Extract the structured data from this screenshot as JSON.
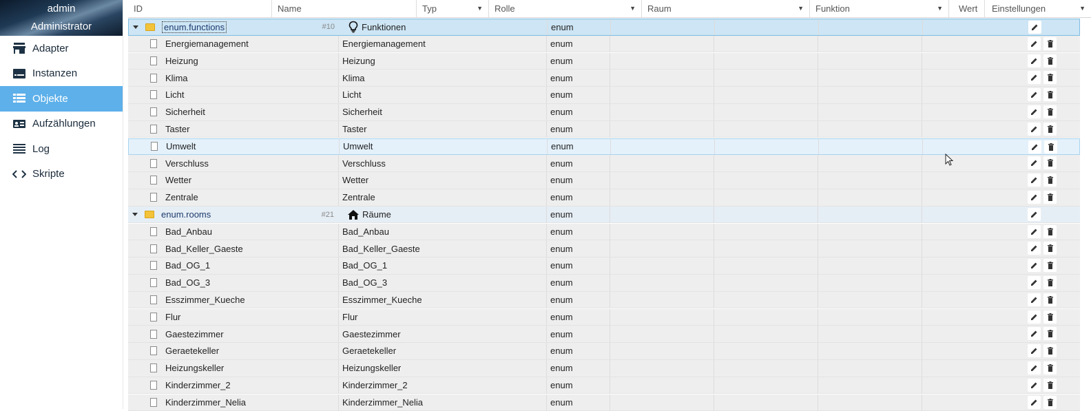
{
  "user": {
    "name": "admin",
    "role": "Administrator"
  },
  "nav": [
    {
      "label": "Adapter",
      "icon": "store-icon",
      "active": false
    },
    {
      "label": "Instanzen",
      "icon": "instances-icon",
      "active": false
    },
    {
      "label": "Objekte",
      "icon": "list-icon",
      "active": true
    },
    {
      "label": "Aufzählungen",
      "icon": "contact-card-icon",
      "active": false
    },
    {
      "label": "Log",
      "icon": "lines-icon",
      "active": false
    },
    {
      "label": "Skripte",
      "icon": "code-icon",
      "active": false
    }
  ],
  "columns": {
    "id": "ID",
    "name": "Name",
    "type": "Typ",
    "role": "Rolle",
    "room": "Raum",
    "function": "Funktion",
    "value": "Wert",
    "settings": "Einstellungen"
  },
  "rows": [
    {
      "kind": "folder",
      "id": "enum.functions",
      "count": "#10",
      "name": "Funktionen",
      "name_icon": "lightbulb-icon",
      "role": "enum",
      "deletable": false,
      "state": "sel1"
    },
    {
      "kind": "item",
      "id": "Energiemanagement",
      "name": "Energiemanagement",
      "role": "enum",
      "deletable": true
    },
    {
      "kind": "item",
      "id": "Heizung",
      "name": "Heizung",
      "role": "enum",
      "deletable": true
    },
    {
      "kind": "item",
      "id": "Klima",
      "name": "Klima",
      "role": "enum",
      "deletable": true
    },
    {
      "kind": "item",
      "id": "Licht",
      "name": "Licht",
      "role": "enum",
      "deletable": true
    },
    {
      "kind": "item",
      "id": "Sicherheit",
      "name": "Sicherheit",
      "role": "enum",
      "deletable": true
    },
    {
      "kind": "item",
      "id": "Taster",
      "name": "Taster",
      "role": "enum",
      "deletable": true
    },
    {
      "kind": "item",
      "id": "Umwelt",
      "name": "Umwelt",
      "role": "enum",
      "deletable": true,
      "state": "sel2"
    },
    {
      "kind": "item",
      "id": "Verschluss",
      "name": "Verschluss",
      "role": "enum",
      "deletable": true
    },
    {
      "kind": "item",
      "id": "Wetter",
      "name": "Wetter",
      "role": "enum",
      "deletable": true
    },
    {
      "kind": "item",
      "id": "Zentrale",
      "name": "Zentrale",
      "role": "enum",
      "deletable": true
    },
    {
      "kind": "folder",
      "id": "enum.rooms",
      "count": "#21",
      "name": "Räume",
      "name_icon": "home-icon",
      "role": "enum",
      "deletable": false
    },
    {
      "kind": "item",
      "id": "Bad_Anbau",
      "name": "Bad_Anbau",
      "role": "enum",
      "deletable": true
    },
    {
      "kind": "item",
      "id": "Bad_Keller_Gaeste",
      "name": "Bad_Keller_Gaeste",
      "role": "enum",
      "deletable": true
    },
    {
      "kind": "item",
      "id": "Bad_OG_1",
      "name": "Bad_OG_1",
      "role": "enum",
      "deletable": true
    },
    {
      "kind": "item",
      "id": "Bad_OG_3",
      "name": "Bad_OG_3",
      "role": "enum",
      "deletable": true
    },
    {
      "kind": "item",
      "id": "Esszimmer_Kueche",
      "name": "Esszimmer_Kueche",
      "role": "enum",
      "deletable": true
    },
    {
      "kind": "item",
      "id": "Flur",
      "name": "Flur",
      "role": "enum",
      "deletable": true
    },
    {
      "kind": "item",
      "id": "Gaestezimmer",
      "name": "Gaestezimmer",
      "role": "enum",
      "deletable": true
    },
    {
      "kind": "item",
      "id": "Geraetekeller",
      "name": "Geraetekeller",
      "role": "enum",
      "deletable": true
    },
    {
      "kind": "item",
      "id": "Heizungskeller",
      "name": "Heizungskeller",
      "role": "enum",
      "deletable": true
    },
    {
      "kind": "item",
      "id": "Kinderzimmer_2",
      "name": "Kinderzimmer_2",
      "role": "enum",
      "deletable": true
    },
    {
      "kind": "item",
      "id": "Kinderzimmer_Nelia",
      "name": "Kinderzimmer_Nelia",
      "role": "enum",
      "deletable": true
    }
  ]
}
